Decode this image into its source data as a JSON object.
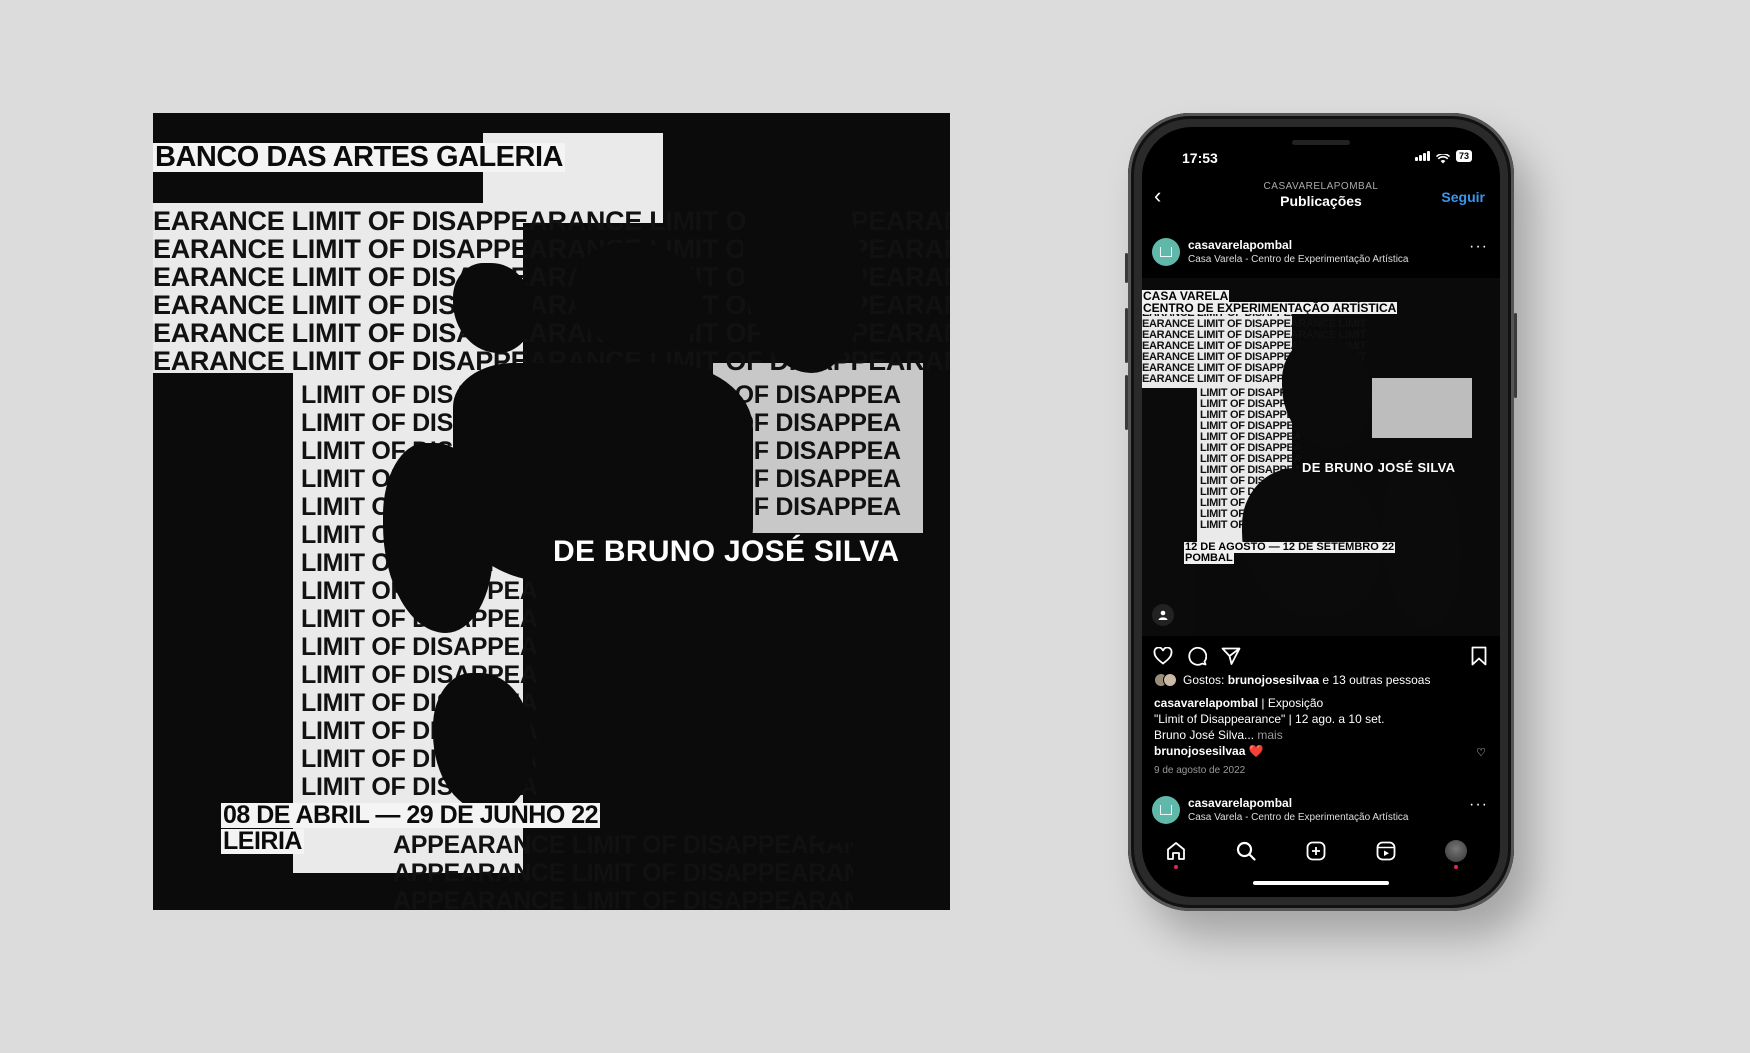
{
  "poster": {
    "title": "BANCO DAS ARTES GALERIA",
    "repeat_top": "EARANCE LIMIT OF DISAPPEARANCE LIMIT OF DISAPPEARANCE",
    "repeat_left": "LIMIT OF DISAPPEA",
    "repeat_right": "T OF DISAPPEA",
    "byline": "DE BRUNO JOSÉ SILVA",
    "dates": "08 DE ABRIL — 29 DE JUNHO 22",
    "location": "LEIRIA",
    "repeat_bottom": "APPEARANCE LIMIT OF DISAPPEARANCE"
  },
  "phone": {
    "time": "17:53",
    "battery": "73",
    "header": {
      "account_caps": "CASAVARELAPOMBAL",
      "title": "Publicações",
      "follow": "Seguir"
    },
    "post": {
      "username": "casavarelapombal",
      "subtitle": "Casa Varela - Centro de Experimentação Artística",
      "image": {
        "label1": "CASA VARELA",
        "label2": "CENTRO DE EXPERIMENTAÇÃO ARTÍSTICA",
        "repeat": "EARANCE LIMIT OF DISAPPEARANCE LIMIT",
        "repeat_left": "LIMIT OF DISAPPEA",
        "byline": "DE BRUNO JOSÉ SILVA",
        "dates": "12 DE AGOSTO — 12 DE SETEMBRO 22",
        "location": "POMBAL"
      },
      "likes_prefix": "Gostos: ",
      "likes_user": "brunojosesilvaa",
      "likes_suffix": " e 13 outras pessoas",
      "caption_user": "casavarelapombal",
      "caption_line1": " | Exposição",
      "caption_line2": "\"Limit of Disappearance\" | 12 ago. a 10 set.",
      "caption_line3": "Bruno José Silva... ",
      "caption_more": "mais",
      "comment_user": "brunojosesilvaa",
      "comment_emoji": "❤️",
      "date": "9 de agosto de 2022"
    },
    "next_post": {
      "username": "casavarelapombal",
      "subtitle": "Casa Varela - Centro de Experimentação Artística"
    }
  }
}
